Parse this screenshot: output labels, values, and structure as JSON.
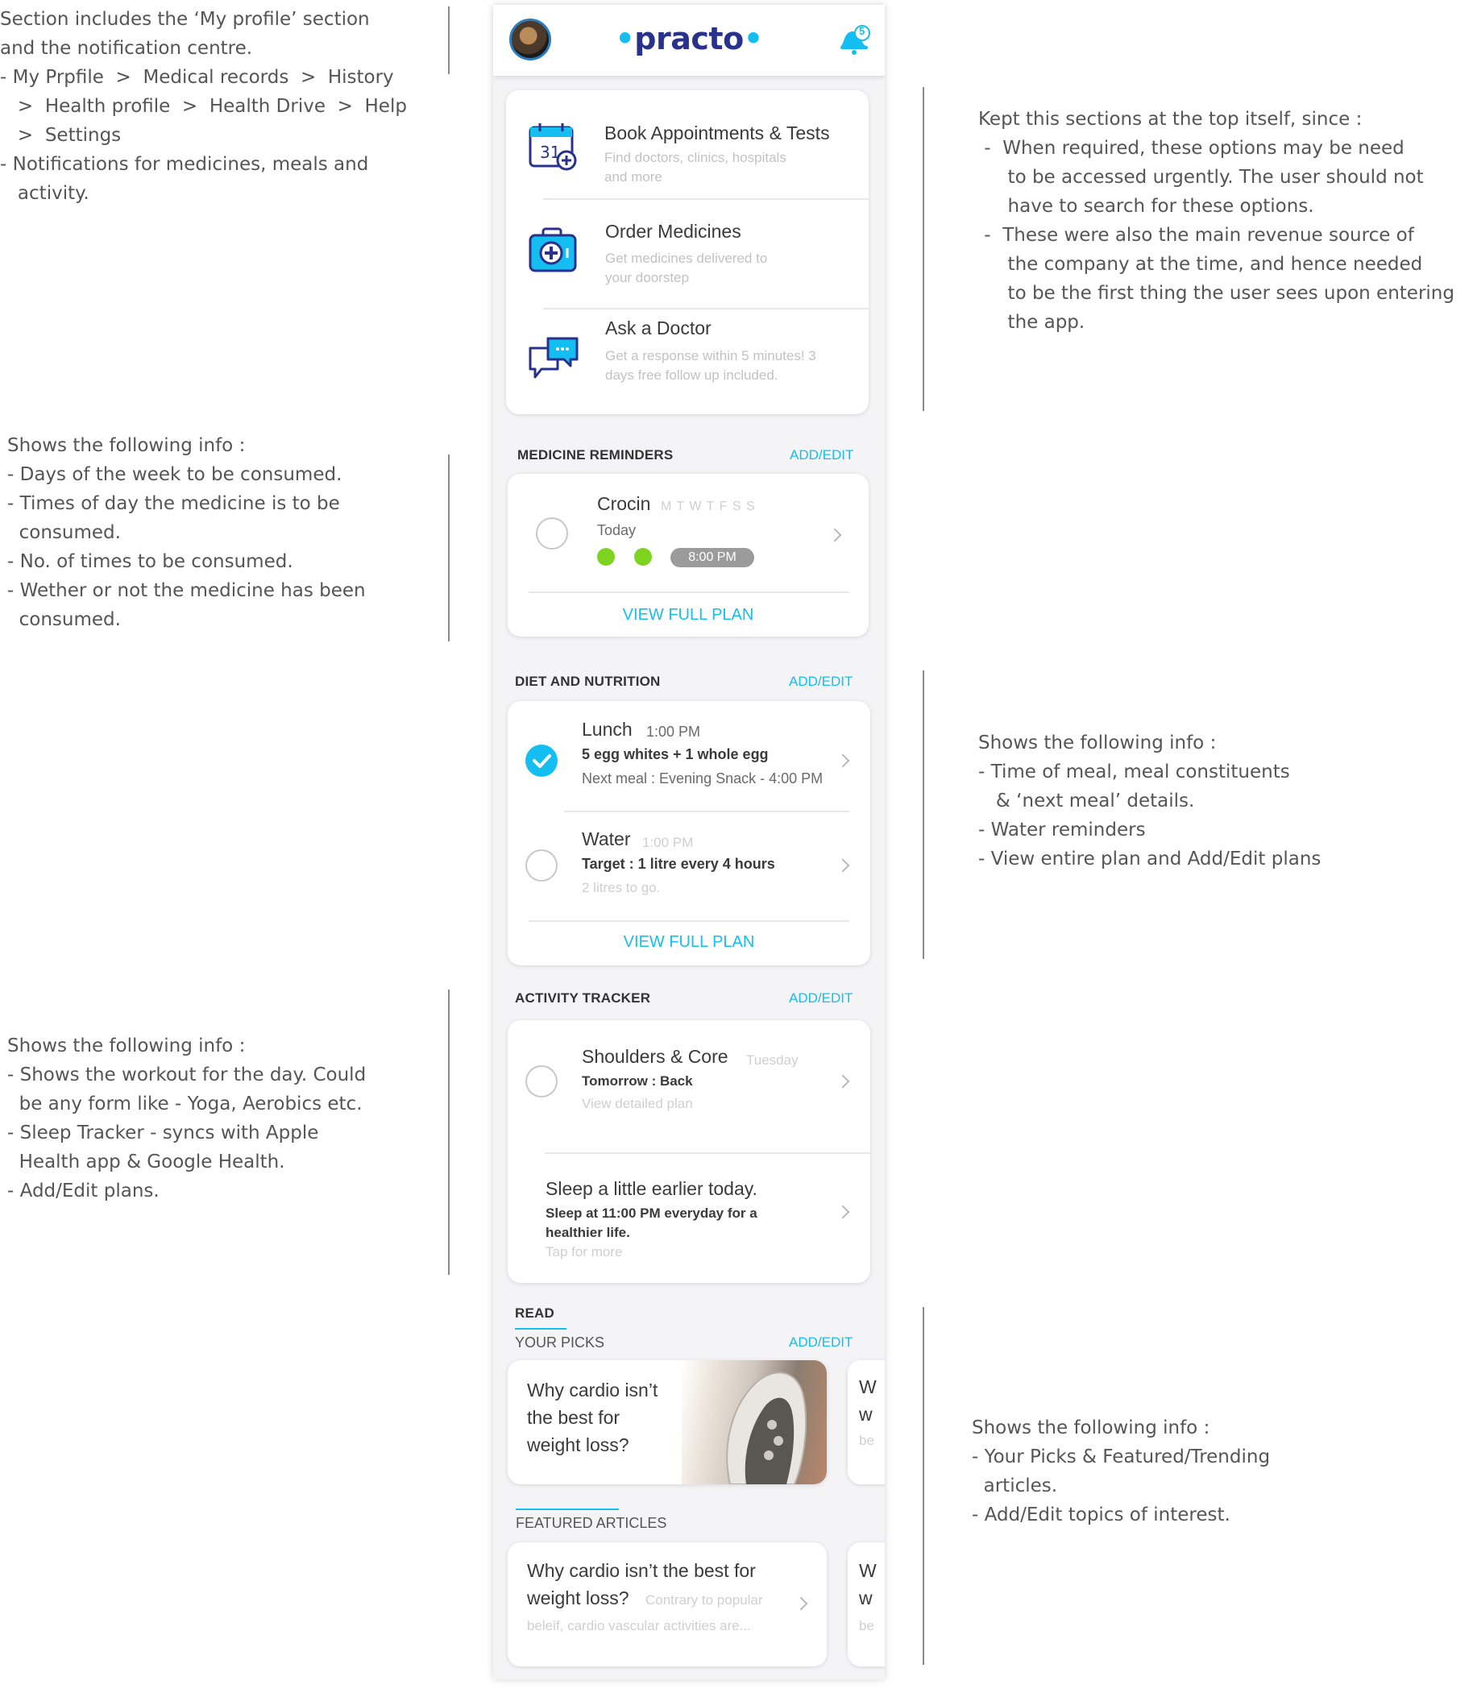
{
  "annotations": {
    "header": [
      "Section includes the ‘My profile’ section",
      "and the notification centre.",
      "",
      "- My Prpfile  >  Medical records  >  History",
      "   >  Health profile  >  Health Drive  >  Help",
      "   >  Settings",
      "- Notifications for medicines, meals and",
      "   activity."
    ],
    "services": [
      "Kept this sections at the top itself, since :",
      "",
      " -  When required, these options may be need",
      "     to be accessed urgently. The user should not",
      "     have to search for these options.",
      "",
      " -  These were also the main revenue source of",
      "     the company at the time, and hence needed",
      "     to be the first thing the user sees upon entering",
      "     the app."
    ],
    "medicine": [
      "Shows the following info :",
      "",
      "- Days of the week to be consumed.",
      "- Times of day the medicine is to be",
      "  consumed.",
      "- No. of times to be consumed.",
      "- Wether or not the medicine has been",
      "  consumed."
    ],
    "diet": [
      "Shows the following info :",
      "",
      "- Time of meal, meal constituents",
      "   & ‘next meal’ details.",
      "- Water reminders",
      "- View entire plan and Add/Edit plans"
    ],
    "activity": [
      "Shows the following info :",
      "",
      "- Shows the workout for the day. Could",
      "  be any form like - Yoga, Aerobics etc.",
      "- Sleep Tracker - syncs with Apple",
      "  Health app & Google Health.",
      "- Add/Edit plans."
    ],
    "read": [
      "Shows the following info :",
      "",
      "- Your Picks & Featured/Trending",
      "  articles.",
      "- Add/Edit topics of interest."
    ]
  },
  "topbar": {
    "logo": "practo",
    "notification_count": "5"
  },
  "services": [
    {
      "title": "Book Appointments & Tests",
      "subtitle": "Find doctors, clinics, hospitals\nand more",
      "icon": "calendar-icon"
    },
    {
      "title": "Order Medicines",
      "subtitle": "Get medicines delivered to\nyour doorstep",
      "icon": "medicine-kit-icon"
    },
    {
      "title": "Ask a Doctor",
      "subtitle": "Get a response within 5 minutes! 3\ndays free follow up included.",
      "icon": "chat-bubbles-icon"
    }
  ],
  "medicine": {
    "title": "MEDICINE REMINDERS",
    "link": "ADD/EDIT",
    "name": "Crocin",
    "days": "M T W T F S S",
    "when": "Today",
    "time": "8:00 PM",
    "cta": "VIEW FULL PLAN"
  },
  "diet": {
    "title": "DIET AND NUTRITION",
    "link": "ADD/EDIT",
    "lunch": {
      "name": "Lunch",
      "time": "1:00 PM",
      "detail": "5 egg whites + 1 whole egg",
      "next": "Next meal : Evening Snack - 4:00 PM"
    },
    "water": {
      "name": "Water",
      "time": "1:00 PM",
      "detail": "Target : 1 litre every 4 hours",
      "note": "2 litres to go."
    },
    "cta": "VIEW FULL PLAN"
  },
  "activity": {
    "title": "ACTIVITY TRACKER",
    "link": "ADD/EDIT",
    "workout": {
      "name": "Shoulders & Core",
      "day": "Tuesday",
      "next": "Tomorrow : Back",
      "link": "View detailed plan"
    },
    "sleep": {
      "title": "Sleep a little earlier today.",
      "detail1": "Sleep at 11:00 PM everyday for a",
      "detail2": "healthier life.",
      "link": "Tap for more"
    }
  },
  "read": {
    "title": "READ",
    "picks": "YOUR PICKS",
    "link": "ADD/EDIT",
    "pick_lines": [
      "Why cardio isn’t",
      "the best for",
      "weight loss?"
    ],
    "peek": [
      "W",
      "w",
      "be"
    ],
    "featured": "FEATURED ARTICLES",
    "featured_line1": "Why cardio isn’t the best for",
    "featured_line2a": "weight loss?",
    "featured_line2b": "Contrary to popular",
    "featured_line3": "beleif, cardio vascular activities are..."
  },
  "colors": {
    "accent": "#14bef0",
    "brand": "#28328c",
    "green": "#7ed321"
  }
}
